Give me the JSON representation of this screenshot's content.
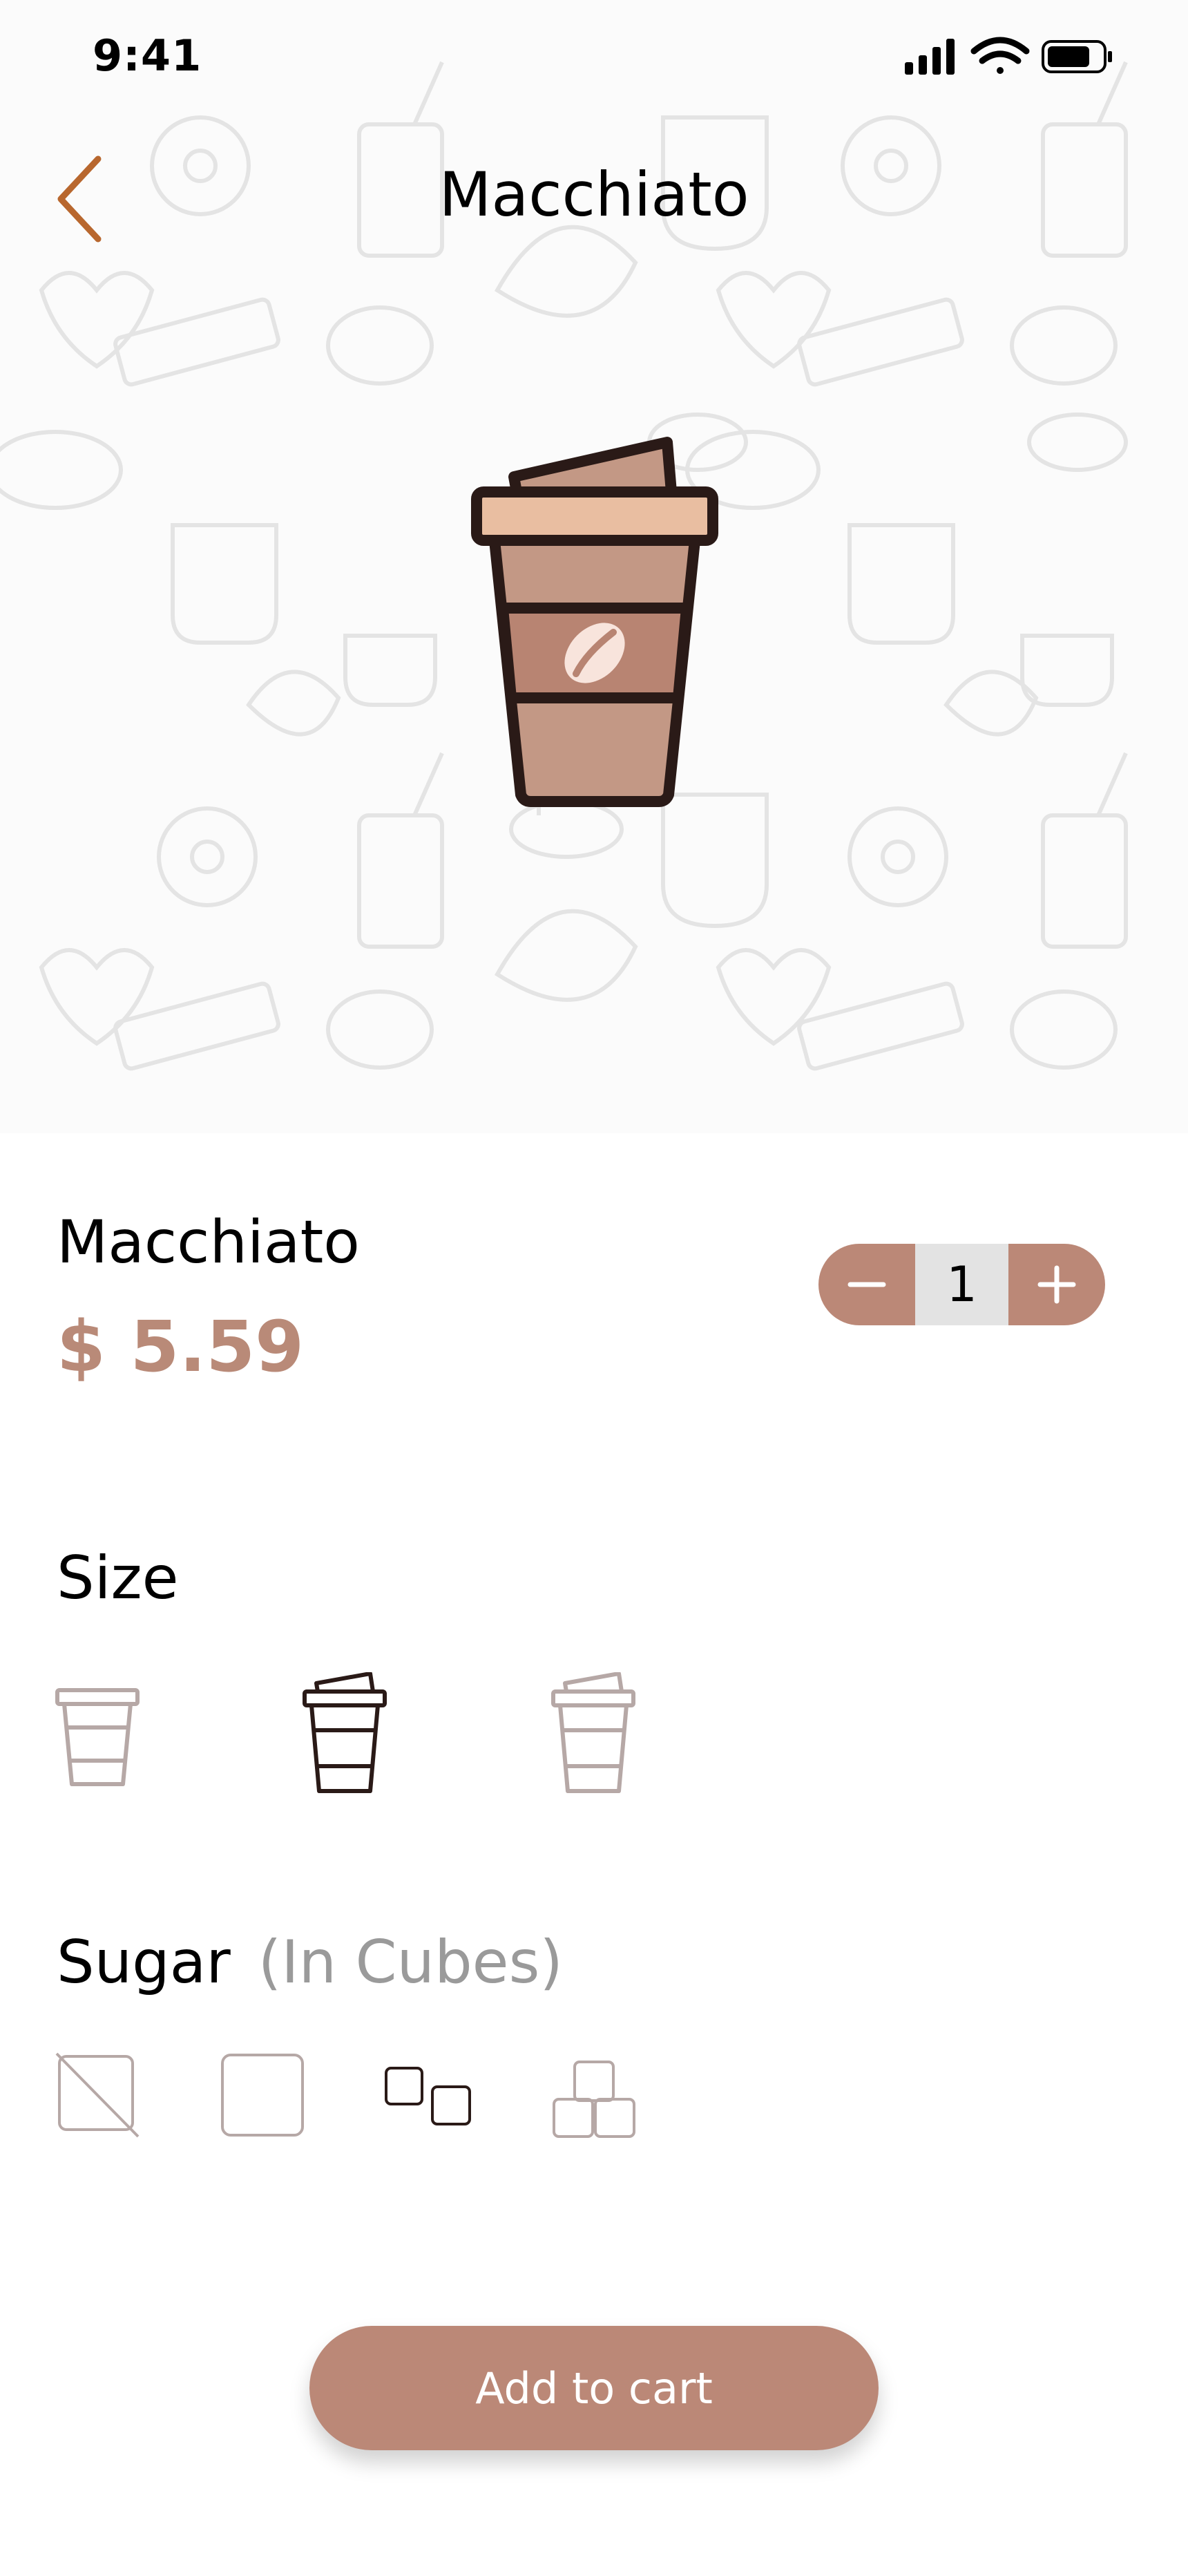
{
  "status_bar": {
    "time": "9:41"
  },
  "nav": {
    "title": "Macchiato"
  },
  "product": {
    "name": "Macchiato",
    "price": "$ 5.59",
    "quantity": "1"
  },
  "size": {
    "label": "Size",
    "options": [
      "small-cup-icon",
      "medium-cup-icon",
      "large-cup-icon"
    ],
    "selected_index": 1
  },
  "sugar": {
    "label": "Sugar",
    "sublabel": "(In Cubes)",
    "options": [
      "no-sugar-icon",
      "one-cube-icon",
      "two-cubes-icon",
      "three-cubes-icon"
    ],
    "selected_index": 2
  },
  "cta": {
    "label": "Add to cart"
  },
  "colors": {
    "accent": "#bb8877",
    "price": "#b98a78",
    "back": "#b8672e",
    "cup_dark": "#2a1a17",
    "cup_body": "#c39885",
    "cup_lid": "#e9bea1"
  }
}
